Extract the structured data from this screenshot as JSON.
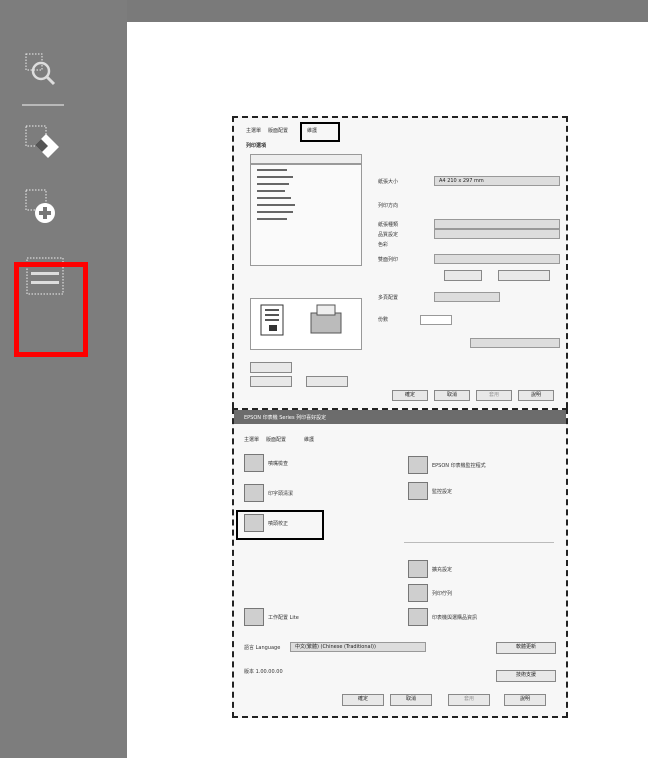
{
  "tools": [
    {
      "name": "zoom-select-tool",
      "icon": "magnifier-icon"
    },
    {
      "name": "erase-select-tool",
      "icon": "eraser-icon"
    },
    {
      "name": "add-select-tool",
      "icon": "plus-icon"
    },
    {
      "name": "text-select-tool",
      "icon": "text-selection-icon",
      "highlighted": true
    }
  ],
  "colors": {
    "sidebar": "#7d7d7d",
    "highlight": "#ff0000"
  },
  "doc_top": {
    "tabs": [
      "主選單",
      "版面配置",
      "維護"
    ],
    "labels": [
      "列印選項",
      "紙張大小",
      "列印方向",
      "紙張種類",
      "品質設定",
      "色彩",
      "雙面列印",
      "多頁配置",
      "份數"
    ],
    "values": {
      "paper": "A4 210 x 297 mm"
    },
    "buttons": [
      "確定",
      "取消",
      "套用",
      "說明"
    ]
  },
  "doc_bottom": {
    "title": "EPSON 印表機 Series 列印喜好設定",
    "tabs": [
      "主選單",
      "版面配置",
      "維護"
    ],
    "items_left": [
      "噴嘴檢查",
      "印字頭清潔",
      "噴頭校正"
    ],
    "items_right": [
      "EPSON 印表機監控程式",
      "監控設定",
      "擴充設定",
      "列印佇列",
      "印表機與選購品資訊"
    ],
    "extra": [
      "工作配置 Lite"
    ],
    "language_label": "語言 Language",
    "language_value": "中文(繁體) (Chinese (Traditional))",
    "update_label": "軟體更新",
    "version_label": "版本 1.00.00.00",
    "support_label": "技術支援",
    "buttons": [
      "確定",
      "取消",
      "套用",
      "說明"
    ]
  }
}
